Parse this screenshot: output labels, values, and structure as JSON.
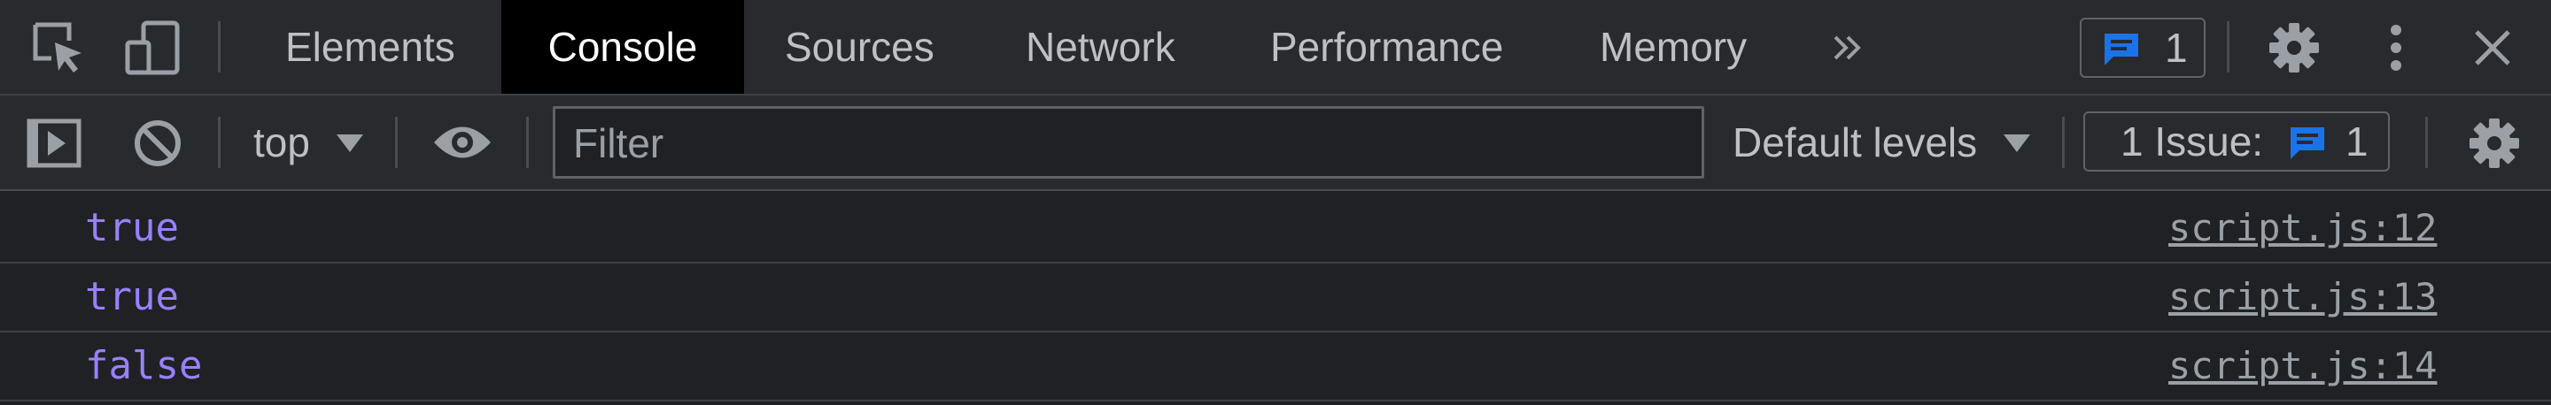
{
  "tabs": [
    {
      "label": "Elements",
      "active": false
    },
    {
      "label": "Console",
      "active": true
    },
    {
      "label": "Sources",
      "active": false
    },
    {
      "label": "Network",
      "active": false
    },
    {
      "label": "Performance",
      "active": false
    },
    {
      "label": "Memory",
      "active": false
    }
  ],
  "top_toolbar": {
    "message_count": "1",
    "icons": [
      "inspect-element-icon",
      "device-toolbar-icon",
      "more-tabs-icon",
      "message-icon",
      "settings-gear-icon",
      "kebab-menu-icon",
      "close-icon"
    ]
  },
  "console_toolbar": {
    "context": "top",
    "filter_placeholder": "Filter",
    "levels": "Default levels",
    "issues_label": "1 Issue:",
    "issues_count": "1",
    "icons": [
      "sidebar-toggle-icon",
      "clear-console-icon",
      "eye-icon",
      "settings-gear-icon"
    ]
  },
  "logs": [
    {
      "value": "true",
      "source": "script.js:12"
    },
    {
      "value": "true",
      "source": "script.js:13"
    },
    {
      "value": "false",
      "source": "script.js:14"
    }
  ],
  "colors": {
    "accent_blue": "#1a73e8",
    "log_value": "#9980ff",
    "active_tab_bg": "#000000",
    "toolbar_bg": "#292a2d"
  }
}
